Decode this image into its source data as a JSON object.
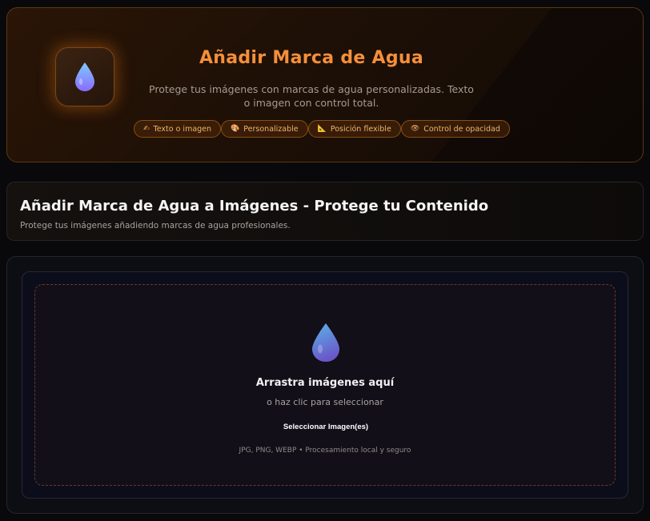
{
  "hero": {
    "title": "Añadir Marca de Agua",
    "subtitle_line1": "Protege tus imágenes con marcas de agua personalizadas. Texto",
    "subtitle_line2": "o imagen con control total.",
    "icon": "water-drop-icon",
    "accent_color": "#f58f3a",
    "badges": [
      {
        "icon": "writing-hand-icon",
        "glyph": "✍",
        "label": "Texto o imagen"
      },
      {
        "icon": "palette-icon",
        "glyph": "🎨",
        "label": "Personalizable"
      },
      {
        "icon": "triangular-ruler-icon",
        "glyph": "📐",
        "label": "Posición flexible"
      },
      {
        "icon": "eye-icon",
        "glyph": "👁",
        "label": "Control de opacidad"
      }
    ]
  },
  "section": {
    "title": "Añadir Marca de Agua a Imágenes - Protege tu Contenido",
    "description": "Protege tus imágenes añadiendo marcas de agua profesionales."
  },
  "upload": {
    "icon": "water-drop-icon",
    "title": "Arrastra imágenes aquí",
    "subtitle": "o haz clic para seleccionar",
    "button_label": "Seleccionar Imagen(es)",
    "formats": "JPG, PNG, WEBP • Procesamiento local y seguro"
  }
}
